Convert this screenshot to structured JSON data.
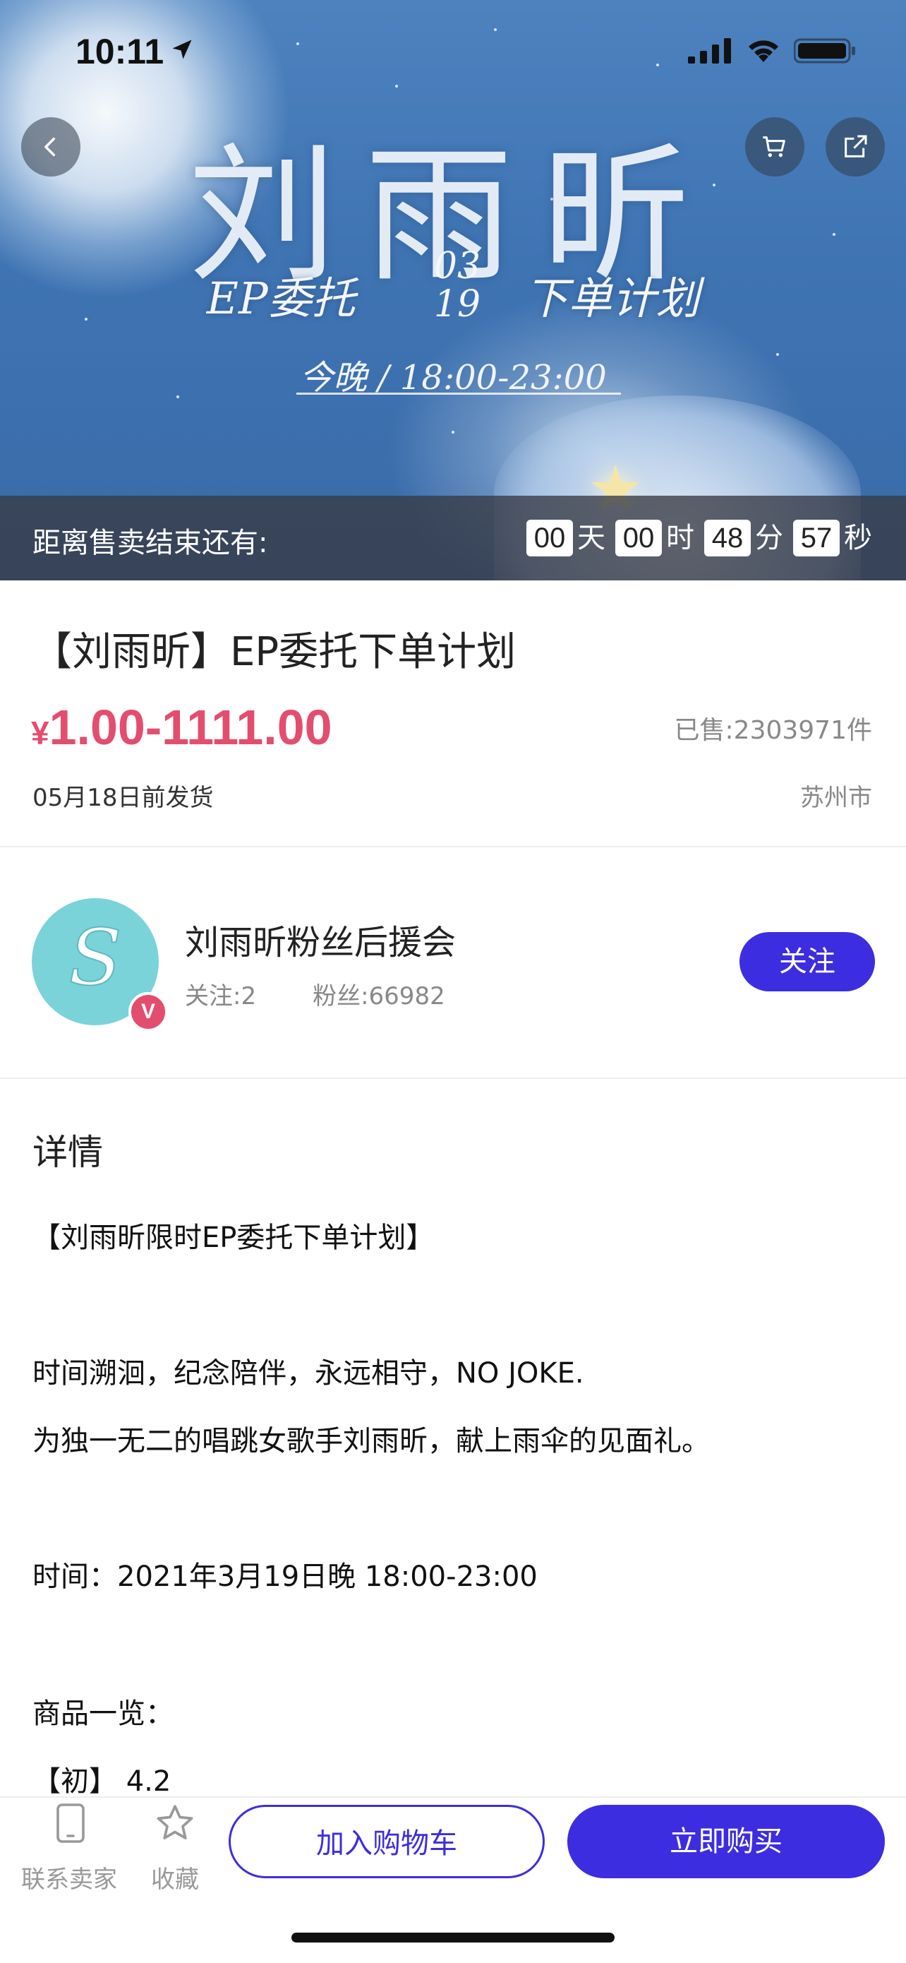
{
  "status_bar": {
    "time": "10:11"
  },
  "banner": {
    "title": "刘雨昕",
    "subtitle_left": "EP委托",
    "date_month": "03",
    "date_day": "19",
    "subtitle_right": "下单计划",
    "time_text": "今晚 / 18:00-23:00"
  },
  "countdown": {
    "label": "距离售卖结束还有:",
    "days": "00",
    "days_unit": "天",
    "hours": "00",
    "hours_unit": "时",
    "minutes": "48",
    "minutes_unit": "分",
    "seconds": "57",
    "seconds_unit": "秒"
  },
  "product": {
    "title": "【刘雨昕】EP委托下单计划",
    "currency": "¥",
    "price_range": "1.00-1111.00",
    "sold": "已售:2303971件",
    "ship_date": "05月18日前发货",
    "city": "苏州市"
  },
  "seller": {
    "name": "刘雨昕粉丝后援会",
    "following": "关注:2",
    "fans": "粉丝:66982",
    "badge": "V",
    "follow_label": "关注"
  },
  "details": {
    "title": "详情",
    "lines": [
      "【刘雨昕限时EP委托下单计划】",
      "时间溯洄，纪念陪伴，永远相守，NO JOKE.",
      "为独一无二的唱跳女歌手刘雨昕，献上雨伞的见面礼。",
      "时间：2021年3月19日晚 18:00-23:00",
      "商品一览：",
      "【初】 4.2"
    ]
  },
  "bottom_bar": {
    "contact_label": "联系卖家",
    "favorite_label": "收藏",
    "add_cart_label": "加入购物车",
    "buy_now_label": "立即购买"
  },
  "colors": {
    "accent": "#3d2de0",
    "price": "#e34d6e",
    "avatar_bg": "#7ad3d8"
  }
}
